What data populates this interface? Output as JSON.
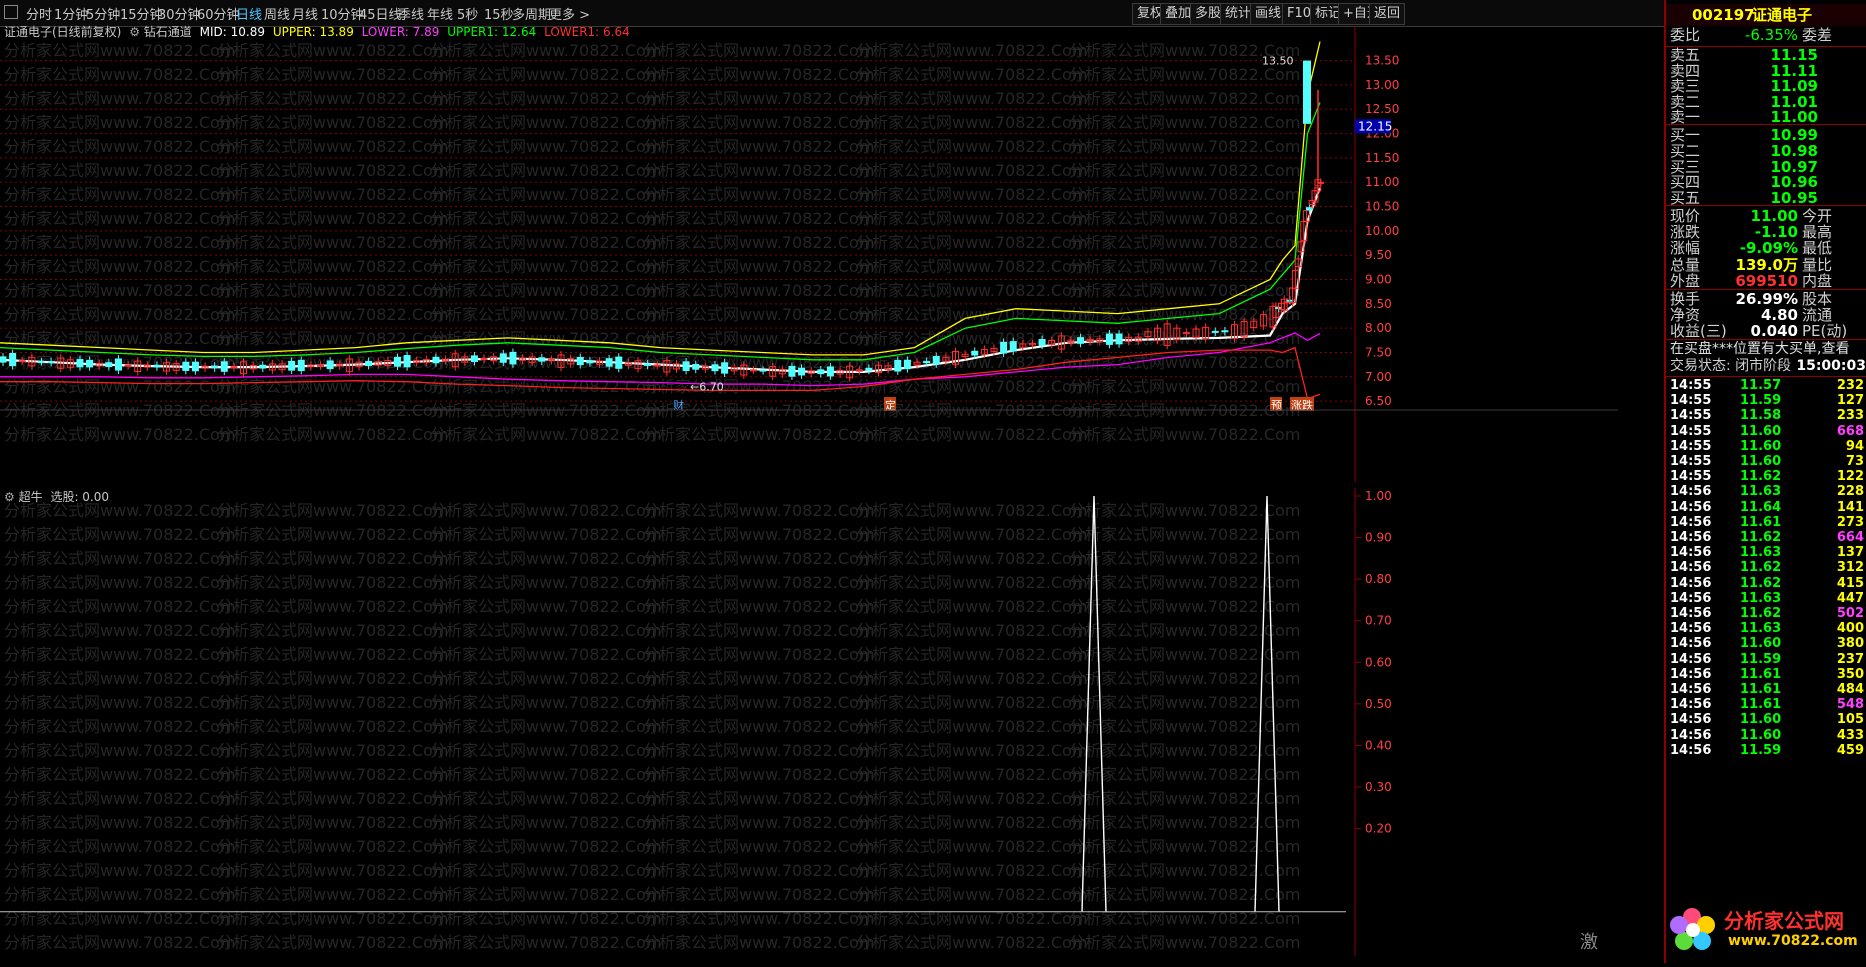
{
  "toolbar": {
    "tabs": [
      "分时",
      "1分钟",
      "5分钟",
      "15分钟",
      "30分钟",
      "60分钟",
      "日线",
      "周线",
      "月线",
      "10分钟",
      "45日线",
      "季线",
      "年线",
      "5秒",
      "15秒",
      "多周期",
      "更多 >"
    ],
    "active_tab": "日线",
    "right_buttons": [
      "复权",
      "叠加",
      "多股",
      "统计",
      "画线",
      "F10",
      "标记",
      "+自选",
      "返回"
    ]
  },
  "main_chart": {
    "stock_label": "证通电子(日线前复权)",
    "indicator_name": "钻石通道",
    "mid": "MID: 10.89",
    "upper": "UPPER: 13.89",
    "lower": "LOWER: 7.89",
    "upper1": "UPPER1: 12.64",
    "lower1": "LOWER1: 6.64",
    "high_marker": "13.50",
    "low_marker": "6.70",
    "current_price_tag": "12.15",
    "event_markers": [
      "财",
      "定",
      "预",
      "涨跌"
    ],
    "watermark": "分析家公式网www.70822.Com",
    "colors": {
      "up": "#ff3030",
      "down": "#54ffff",
      "mid": "#ffffff",
      "upper": "#ffff00",
      "upper1": "#00ff00",
      "lower": "#ff00ff",
      "lower1": "#ff2020",
      "grid": "#8b0000",
      "axis": "#ff4040"
    }
  },
  "chart_data": [
    {
      "type": "line",
      "title": "钻石通道",
      "ylim": [
        6.4,
        13.8
      ],
      "y_ticks": [
        "13.50",
        "13.00",
        "12.50",
        "12.00",
        "11.50",
        "11.00",
        "10.50",
        "10.00",
        "9.50",
        "9.00",
        "8.50",
        "8.00",
        "7.50",
        "7.00",
        "6.50"
      ],
      "series": [
        {
          "name": "MID",
          "values": [
            7.35,
            7.3,
            7.25,
            7.22,
            7.2,
            7.2,
            7.22,
            7.25,
            7.3,
            7.35,
            7.38,
            7.35,
            7.3,
            7.25,
            7.2,
            7.15,
            7.1,
            7.1,
            7.2,
            7.35,
            7.55,
            7.7,
            7.75,
            7.78,
            7.8,
            7.85,
            8.3,
            8.5,
            10.2,
            10.89
          ]
        },
        {
          "name": "UPPER",
          "values": [
            7.7,
            7.65,
            7.6,
            7.55,
            7.5,
            7.5,
            7.55,
            7.6,
            7.7,
            7.75,
            7.8,
            7.75,
            7.7,
            7.6,
            7.55,
            7.5,
            7.45,
            7.45,
            7.6,
            8.2,
            8.4,
            8.35,
            8.3,
            8.4,
            8.5,
            9.0,
            9.4,
            9.7,
            12.8,
            13.89
          ]
        },
        {
          "name": "UPPER1",
          "values": [
            7.6,
            7.55,
            7.5,
            7.45,
            7.42,
            7.42,
            7.45,
            7.5,
            7.58,
            7.65,
            7.7,
            7.65,
            7.6,
            7.5,
            7.45,
            7.4,
            7.35,
            7.35,
            7.5,
            8.0,
            8.2,
            8.15,
            8.1,
            8.2,
            8.3,
            8.8,
            9.1,
            9.4,
            12.0,
            12.64
          ]
        },
        {
          "name": "LOWER",
          "values": [
            7.0,
            7.0,
            7.0,
            6.98,
            6.98,
            7.0,
            7.02,
            7.05,
            7.05,
            7.0,
            6.95,
            6.92,
            6.9,
            6.88,
            6.85,
            6.85,
            6.82,
            6.85,
            6.95,
            7.0,
            7.1,
            7.2,
            7.25,
            7.4,
            7.5,
            7.7,
            7.8,
            7.9,
            7.75,
            7.89
          ]
        },
        {
          "name": "LOWER1",
          "values": [
            6.9,
            6.9,
            6.88,
            6.86,
            6.86,
            6.88,
            6.9,
            6.92,
            6.9,
            6.85,
            6.82,
            6.78,
            6.76,
            6.74,
            6.72,
            6.72,
            6.72,
            6.8,
            6.95,
            7.05,
            7.15,
            7.3,
            7.4,
            7.5,
            7.55,
            7.55,
            7.5,
            7.6,
            6.55,
            6.64
          ]
        }
      ]
    },
    {
      "type": "line",
      "title": "超牛",
      "ylim": [
        0,
        1.0
      ],
      "y_ticks": [
        "1.00",
        "0.90",
        "0.80",
        "0.70",
        "0.60",
        "0.50",
        "0.40",
        "0.30",
        "0.20"
      ],
      "series": [
        {
          "name": "选股",
          "values": [
            0,
            0,
            0,
            0,
            0,
            0,
            0,
            0,
            0,
            0,
            0,
            0,
            0,
            0,
            0,
            0,
            0,
            0,
            0,
            0,
            0,
            1,
            0,
            0,
            0,
            0,
            0,
            0,
            1,
            0,
            0
          ]
        }
      ]
    }
  ],
  "indicator": {
    "name": "超牛",
    "label": "选股: 0.00",
    "footer_char": "激"
  },
  "panel": {
    "code": "002197",
    "name": "证通电子",
    "weibi_label": "委比",
    "weibi_value": "-6.35%",
    "weicha_label": "委差",
    "asks": [
      {
        "label": "卖五",
        "price": "11.15"
      },
      {
        "label": "卖四",
        "price": "11.11"
      },
      {
        "label": "卖三",
        "price": "11.09"
      },
      {
        "label": "卖二",
        "price": "11.01"
      },
      {
        "label": "卖一",
        "price": "11.00"
      }
    ],
    "bids": [
      {
        "label": "买一",
        "price": "10.99"
      },
      {
        "label": "买二",
        "price": "10.98"
      },
      {
        "label": "买三",
        "price": "10.97"
      },
      {
        "label": "买四",
        "price": "10.96"
      },
      {
        "label": "买五",
        "price": "10.95"
      }
    ],
    "stats": [
      {
        "k": "现价",
        "v": "11.00",
        "k2": "今开",
        "color": "green"
      },
      {
        "k": "涨跌",
        "v": "-1.10",
        "k2": "最高",
        "color": "green"
      },
      {
        "k": "涨幅",
        "v": "-9.09%",
        "k2": "最低",
        "color": "green"
      },
      {
        "k": "总量",
        "v": "139.0万",
        "k2": "量比",
        "color": "yellow"
      },
      {
        "k": "外盘",
        "v": "699510",
        "k2": "内盘",
        "color": "red"
      }
    ],
    "stats2": [
      {
        "k": "换手",
        "v": "26.99%",
        "k2": "股本"
      },
      {
        "k": "净资",
        "v": "4.80",
        "k2": "流通"
      },
      {
        "k": "收益(三)",
        "v": "0.040",
        "k2": "PE(动)"
      }
    ],
    "notice": "在买盘***位置有大买单,查看",
    "trade_status": "交易状态: 闭市阶段",
    "trade_time": "15:00:03",
    "ticks": [
      {
        "t": "14:55",
        "p": "11.57",
        "v": "232",
        "c": "yellow"
      },
      {
        "t": "14:55",
        "p": "11.59",
        "v": "127",
        "c": "yellow"
      },
      {
        "t": "14:55",
        "p": "11.58",
        "v": "233",
        "c": "yellow"
      },
      {
        "t": "14:55",
        "p": "11.60",
        "v": "668",
        "c": "magenta"
      },
      {
        "t": "14:55",
        "p": "11.60",
        "v": "94",
        "c": "yellow"
      },
      {
        "t": "14:55",
        "p": "11.60",
        "v": "73",
        "c": "yellow"
      },
      {
        "t": "14:55",
        "p": "11.62",
        "v": "122",
        "c": "yellow"
      },
      {
        "t": "14:56",
        "p": "11.63",
        "v": "228",
        "c": "yellow"
      },
      {
        "t": "14:56",
        "p": "11.64",
        "v": "141",
        "c": "yellow"
      },
      {
        "t": "14:56",
        "p": "11.61",
        "v": "273",
        "c": "yellow"
      },
      {
        "t": "14:56",
        "p": "11.62",
        "v": "664",
        "c": "magenta"
      },
      {
        "t": "14:56",
        "p": "11.63",
        "v": "137",
        "c": "yellow"
      },
      {
        "t": "14:56",
        "p": "11.62",
        "v": "312",
        "c": "yellow"
      },
      {
        "t": "14:56",
        "p": "11.62",
        "v": "415",
        "c": "yellow"
      },
      {
        "t": "14:56",
        "p": "11.63",
        "v": "447",
        "c": "yellow"
      },
      {
        "t": "14:56",
        "p": "11.62",
        "v": "502",
        "c": "magenta"
      },
      {
        "t": "14:56",
        "p": "11.63",
        "v": "400",
        "c": "yellow"
      },
      {
        "t": "14:56",
        "p": "11.60",
        "v": "380",
        "c": "yellow"
      },
      {
        "t": "14:56",
        "p": "11.59",
        "v": "237",
        "c": "yellow"
      },
      {
        "t": "14:56",
        "p": "11.61",
        "v": "350",
        "c": "yellow"
      },
      {
        "t": "14:56",
        "p": "11.61",
        "v": "484",
        "c": "yellow"
      },
      {
        "t": "14:56",
        "p": "11.61",
        "v": "548",
        "c": "magenta"
      },
      {
        "t": "14:56",
        "p": "11.60",
        "v": "105",
        "c": "yellow"
      },
      {
        "t": "14:56",
        "p": "11.60",
        "v": "433",
        "c": "yellow"
      },
      {
        "t": "14:56",
        "p": "11.59",
        "v": "459",
        "c": "yellow"
      }
    ],
    "logo_text": "分析家公式网",
    "logo_url": "www.70822.com"
  }
}
